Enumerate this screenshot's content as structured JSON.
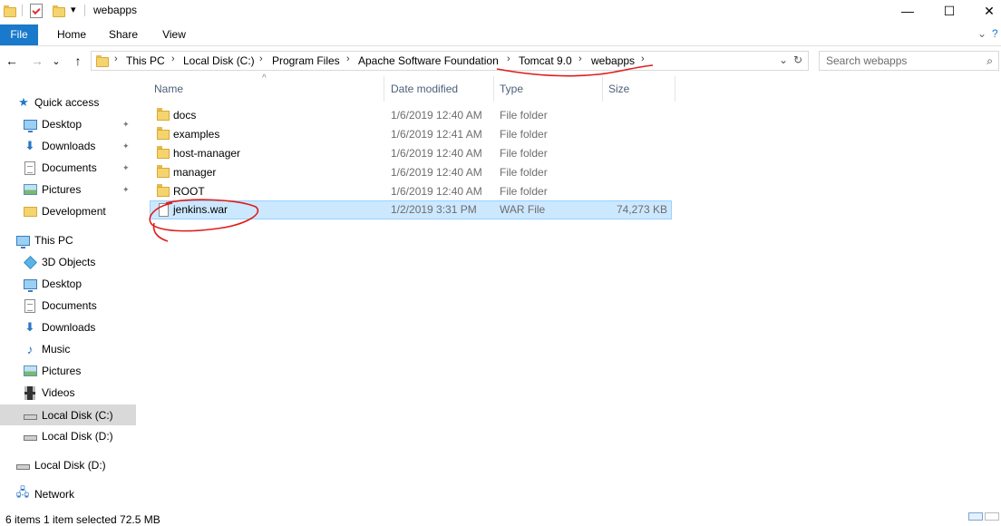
{
  "window": {
    "title": "webapps",
    "minimize_glyph": "—",
    "maximize_glyph": "☐",
    "close_glyph": "✕"
  },
  "quick_access_toolbar": {
    "icons": [
      "folder-icon",
      "properties-icon",
      "new-folder-icon"
    ],
    "dropdown_glyph": "▾"
  },
  "ribbon": {
    "tabs": [
      "File",
      "Home",
      "Share",
      "View"
    ],
    "expand_glyph": "⌄",
    "help_glyph": "?"
  },
  "navigation": {
    "back_glyph": "←",
    "forward_glyph": "→",
    "recent_glyph": "⌄",
    "up_glyph": "↑"
  },
  "address_bar": {
    "breadcrumbs": [
      "This PC",
      "Local Disk (C:)",
      "Program Files",
      "Apache Software Foundation",
      "Tomcat 9.0",
      "webapps"
    ],
    "separator_glyph": "›",
    "dropdown_glyph": "⌄",
    "refresh_glyph": "↻"
  },
  "search": {
    "placeholder": "Search webapps",
    "icon_glyph": "⌕"
  },
  "sidebar": {
    "pin_glyph": "📌",
    "items": [
      {
        "label": "Quick access",
        "icon": "star-icon"
      },
      {
        "label": "Desktop",
        "icon": "desktop-icon",
        "pinned": true
      },
      {
        "label": "Downloads",
        "icon": "downloads-icon",
        "pinned": true
      },
      {
        "label": "Documents",
        "icon": "documents-icon",
        "pinned": true
      },
      {
        "label": "Pictures",
        "icon": "pictures-icon",
        "pinned": true
      },
      {
        "label": "Development",
        "icon": "folder-icon",
        "pinned": false
      },
      {
        "label": "This PC",
        "icon": "computer-icon"
      },
      {
        "label": "3D Objects",
        "icon": "cube-icon"
      },
      {
        "label": "Desktop",
        "icon": "desktop-icon"
      },
      {
        "label": "Documents",
        "icon": "documents-icon"
      },
      {
        "label": "Downloads",
        "icon": "downloads-icon"
      },
      {
        "label": "Music",
        "icon": "music-icon"
      },
      {
        "label": "Pictures",
        "icon": "pictures-icon"
      },
      {
        "label": "Videos",
        "icon": "videos-icon"
      },
      {
        "label": "Local Disk (C:)",
        "icon": "drive-icon",
        "selected": true
      },
      {
        "label": "Local Disk (D:)",
        "icon": "drive-icon"
      },
      {
        "label": "Local Disk (D:)",
        "icon": "drive-icon"
      },
      {
        "label": "Network",
        "icon": "network-icon"
      }
    ]
  },
  "file_list": {
    "columns": [
      "Name",
      "Date modified",
      "Type",
      "Size"
    ],
    "sort_glyph": "^",
    "rows": [
      {
        "name": "docs",
        "date": "1/6/2019 12:40 AM",
        "type": "File folder",
        "size": "",
        "kind": "folder"
      },
      {
        "name": "examples",
        "date": "1/6/2019 12:41 AM",
        "type": "File folder",
        "size": "",
        "kind": "folder"
      },
      {
        "name": "host-manager",
        "date": "1/6/2019 12:40 AM",
        "type": "File folder",
        "size": "",
        "kind": "folder"
      },
      {
        "name": "manager",
        "date": "1/6/2019 12:40 AM",
        "type": "File folder",
        "size": "",
        "kind": "folder"
      },
      {
        "name": "ROOT",
        "date": "1/6/2019 12:40 AM",
        "type": "File folder",
        "size": "",
        "kind": "folder"
      },
      {
        "name": "jenkins.war",
        "date": "1/2/2019 3:31 PM",
        "type": "WAR File",
        "size": "74,273 KB",
        "kind": "file",
        "selected": true
      }
    ]
  },
  "status_bar": {
    "text": "6 items    1 item selected  72.5 MB"
  },
  "colors": {
    "accent": "#1979ca",
    "selection": "#cce8ff",
    "selection_border": "#99d1ff",
    "annotation": "#e01b1b"
  }
}
